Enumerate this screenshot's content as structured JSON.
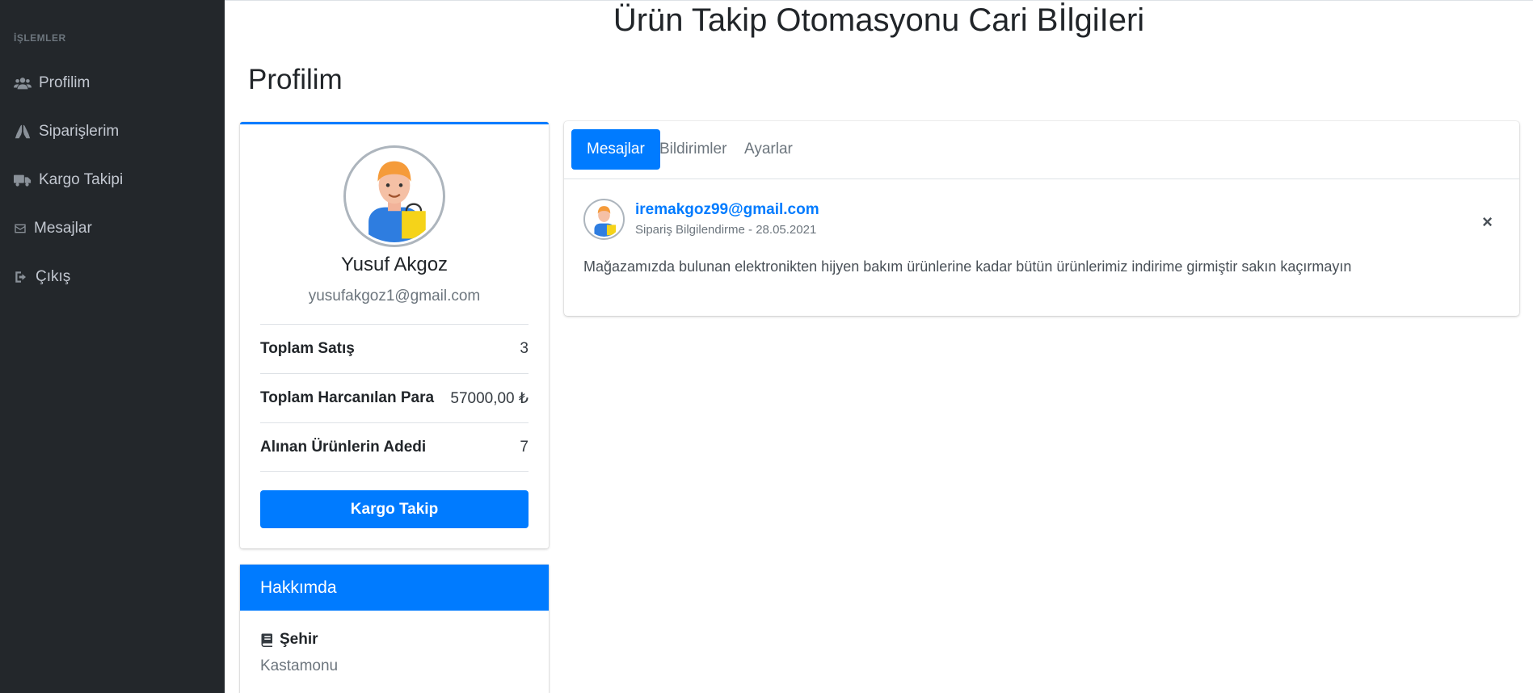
{
  "sidebar": {
    "header": "İŞLEMLER",
    "items": [
      {
        "label": "Profilim",
        "icon": "users-icon"
      },
      {
        "label": "Siparişlerim",
        "icon": "hands-icon"
      },
      {
        "label": "Kargo Takipi",
        "icon": "truck-icon"
      },
      {
        "label": "Mesajlar",
        "icon": "envelope-icon"
      },
      {
        "label": "Çıkış",
        "icon": "sign-out-icon"
      }
    ]
  },
  "page": {
    "heading": "Ürün Takip Otomasyonu Cari BİlgiIeri",
    "section_title": "Profilim"
  },
  "profile": {
    "name": "Yusuf Akgoz",
    "email": "yusufakgoz1@gmail.com",
    "stats": [
      {
        "label": "Toplam Satış",
        "value": "3"
      },
      {
        "label": "Toplam Harcanılan Para",
        "value": "57000,00 ₺"
      },
      {
        "label": "Alınan Ürünlerin Adedi",
        "value": "7"
      }
    ],
    "button_label": "Kargo Takip"
  },
  "about": {
    "header": "Hakkımda",
    "item_title": "Şehir",
    "item_value": "Kastamonu"
  },
  "messages": {
    "tabs": [
      "Mesajlar",
      "Bildirimler",
      "Ayarlar"
    ],
    "active_tab": "Mesajlar",
    "item": {
      "sender": "iremakgoz99@gmail.com",
      "meta": "Sipariş Bilgilendirme - 28.05.2021",
      "body": "Mağazamızda bulunan elektronikten hijyen bakım ürünlerine kadar bütün ürünlerimiz indirime girmiştir sakın kaçırmayın",
      "close": "×"
    }
  },
  "colors": {
    "sidebar_bg": "#23272b",
    "primary": "#007bff",
    "muted": "#6c757d"
  }
}
